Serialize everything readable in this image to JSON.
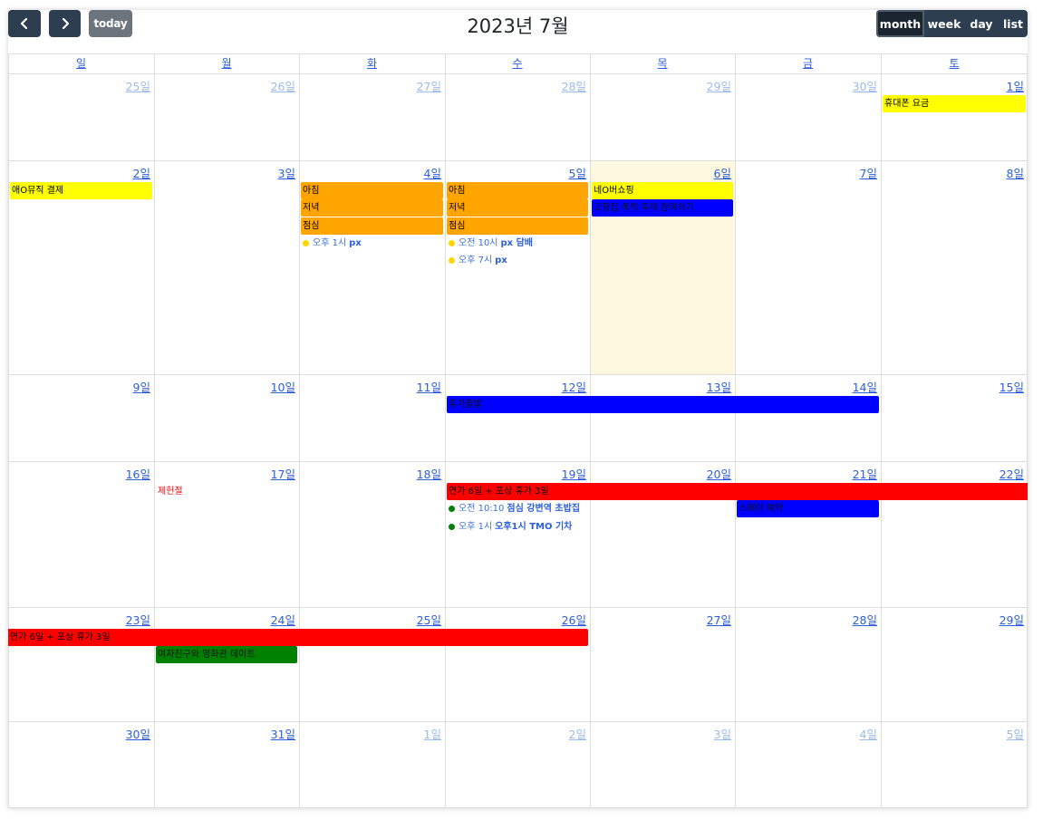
{
  "header": {
    "title": "2023년 7월",
    "today_label": "today",
    "prev_icon": "chevron-left-icon",
    "next_icon": "chevron-right-icon",
    "views": [
      {
        "key": "month",
        "label": "month",
        "active": true
      },
      {
        "key": "week",
        "label": "week",
        "active": false
      },
      {
        "key": "day",
        "label": "day",
        "active": false
      },
      {
        "key": "list",
        "label": "list",
        "active": false
      }
    ]
  },
  "colors": {
    "button": "#2c3e50",
    "button_active": "#1a252f",
    "today_button": "#6c757d",
    "link": "#2c5fd8",
    "other_month": "#9bbbe9",
    "today_highlight": "#fff8e1",
    "grid_line": "#dddddd"
  },
  "weekdays": [
    "일",
    "월",
    "화",
    "수",
    "목",
    "금",
    "토"
  ],
  "weeks": [
    [
      {
        "label": "25일",
        "other": true
      },
      {
        "label": "26일",
        "other": true
      },
      {
        "label": "27일",
        "other": true
      },
      {
        "label": "28일",
        "other": true
      },
      {
        "label": "29일",
        "other": true
      },
      {
        "label": "30일",
        "other": true
      },
      {
        "label": "1일",
        "other": false
      }
    ],
    [
      {
        "label": "2일",
        "other": false
      },
      {
        "label": "3일",
        "other": false
      },
      {
        "label": "4일",
        "other": false
      },
      {
        "label": "5일",
        "other": false
      },
      {
        "label": "6일",
        "other": false,
        "today": true
      },
      {
        "label": "7일",
        "other": false
      },
      {
        "label": "8일",
        "other": false
      }
    ],
    [
      {
        "label": "9일",
        "other": false
      },
      {
        "label": "10일",
        "other": false
      },
      {
        "label": "11일",
        "other": false
      },
      {
        "label": "12일",
        "other": false
      },
      {
        "label": "13일",
        "other": false
      },
      {
        "label": "14일",
        "other": false
      },
      {
        "label": "15일",
        "other": false
      }
    ],
    [
      {
        "label": "16일",
        "other": false
      },
      {
        "label": "17일",
        "other": false
      },
      {
        "label": "18일",
        "other": false
      },
      {
        "label": "19일",
        "other": false
      },
      {
        "label": "20일",
        "other": false
      },
      {
        "label": "21일",
        "other": false
      },
      {
        "label": "22일",
        "other": false
      }
    ],
    [
      {
        "label": "23일",
        "other": false
      },
      {
        "label": "24일",
        "other": false
      },
      {
        "label": "25일",
        "other": false
      },
      {
        "label": "26일",
        "other": false
      },
      {
        "label": "27일",
        "other": false
      },
      {
        "label": "28일",
        "other": false
      },
      {
        "label": "29일",
        "other": false
      }
    ],
    [
      {
        "label": "30일",
        "other": false
      },
      {
        "label": "31일",
        "other": false
      },
      {
        "label": "1일",
        "other": true
      },
      {
        "label": "2일",
        "other": true
      },
      {
        "label": "3일",
        "other": true
      },
      {
        "label": "4일",
        "other": true
      },
      {
        "label": "5일",
        "other": true
      }
    ]
  ],
  "events": [
    {
      "kind": "block",
      "week": 0,
      "startDay": 6,
      "span": 1,
      "slot": 0,
      "title": "휴대폰 요금",
      "bg": "#ffff00",
      "fg": "#000000"
    },
    {
      "kind": "block",
      "week": 1,
      "startDay": 0,
      "span": 1,
      "slot": 0,
      "title": "애O뮤직 결제",
      "bg": "#ffff00",
      "fg": "#000000"
    },
    {
      "kind": "block",
      "week": 1,
      "startDay": 2,
      "span": 1,
      "slot": 0,
      "title": "아침",
      "bg": "#ffa500",
      "fg": "#000000"
    },
    {
      "kind": "block",
      "week": 1,
      "startDay": 2,
      "span": 1,
      "slot": 1,
      "title": "저녁",
      "bg": "#ffa500",
      "fg": "#000000"
    },
    {
      "kind": "block",
      "week": 1,
      "startDay": 2,
      "span": 1,
      "slot": 2,
      "title": "점심",
      "bg": "#ffa500",
      "fg": "#000000"
    },
    {
      "kind": "dot",
      "week": 1,
      "startDay": 2,
      "slot": 3,
      "time": "오후 1시",
      "title": "px",
      "dot": "#ffd500"
    },
    {
      "kind": "block",
      "week": 1,
      "startDay": 3,
      "span": 1,
      "slot": 0,
      "title": "아침",
      "bg": "#ffa500",
      "fg": "#000000"
    },
    {
      "kind": "block",
      "week": 1,
      "startDay": 3,
      "span": 1,
      "slot": 1,
      "title": "저녁",
      "bg": "#ffa500",
      "fg": "#000000"
    },
    {
      "kind": "block",
      "week": 1,
      "startDay": 3,
      "span": 1,
      "slot": 2,
      "title": "점심",
      "bg": "#ffa500",
      "fg": "#000000"
    },
    {
      "kind": "dot",
      "week": 1,
      "startDay": 3,
      "slot": 3,
      "time": "오전 10시",
      "title": "px 담배",
      "dot": "#ffd500"
    },
    {
      "kind": "dot",
      "week": 1,
      "startDay": 3,
      "slot": 4,
      "time": "오후 7시",
      "title": "px",
      "dot": "#ffd500"
    },
    {
      "kind": "block",
      "week": 1,
      "startDay": 4,
      "span": 1,
      "slot": 0,
      "title": "네O버쇼핑",
      "bg": "#ffff00",
      "fg": "#000000"
    },
    {
      "kind": "block",
      "week": 1,
      "startDay": 4,
      "span": 1,
      "slot": 1,
      "title": "고향집 폭력 축제 참여하기",
      "bg": "#0000ff",
      "fg": "#111111"
    },
    {
      "kind": "block",
      "week": 2,
      "startDay": 3,
      "span": 3,
      "slot": 0,
      "title": "휴가출발",
      "bg": "#0000ff",
      "fg": "#111111"
    },
    {
      "kind": "text",
      "week": 3,
      "startDay": 1,
      "slot": 0,
      "title": "제헌절",
      "fg": "#ff0000"
    },
    {
      "kind": "block",
      "week": 3,
      "startDay": 3,
      "span": 4,
      "slot": 0,
      "title": "연가 6일 + 포상 휴가 3일",
      "bg": "#ff0000",
      "fg": "#000000",
      "continues": true
    },
    {
      "kind": "dot",
      "week": 3,
      "startDay": 3,
      "slot": 1,
      "time": "오전 10:10",
      "title": "점심 강변역 초밥집",
      "dot": "#008000"
    },
    {
      "kind": "dot",
      "week": 3,
      "startDay": 3,
      "slot": 2,
      "time": "오후 1시",
      "title": "오후1시 TMO 기차",
      "dot": "#008000"
    },
    {
      "kind": "block",
      "week": 3,
      "startDay": 5,
      "span": 1,
      "slot": 1,
      "title": "스페이 예약",
      "bg": "#0000ff",
      "fg": "#111111"
    },
    {
      "kind": "block",
      "week": 4,
      "startDay": 0,
      "span": 4,
      "slot": 0,
      "title": "연가 6일 + 포상 휴가 3일",
      "bg": "#ff0000",
      "fg": "#000000",
      "fromPrev": true
    },
    {
      "kind": "block",
      "week": 4,
      "startDay": 1,
      "span": 1,
      "slot": 1,
      "title": "여자친구와 영화관 데이트",
      "bg": "#008000",
      "fg": "#111111"
    }
  ]
}
